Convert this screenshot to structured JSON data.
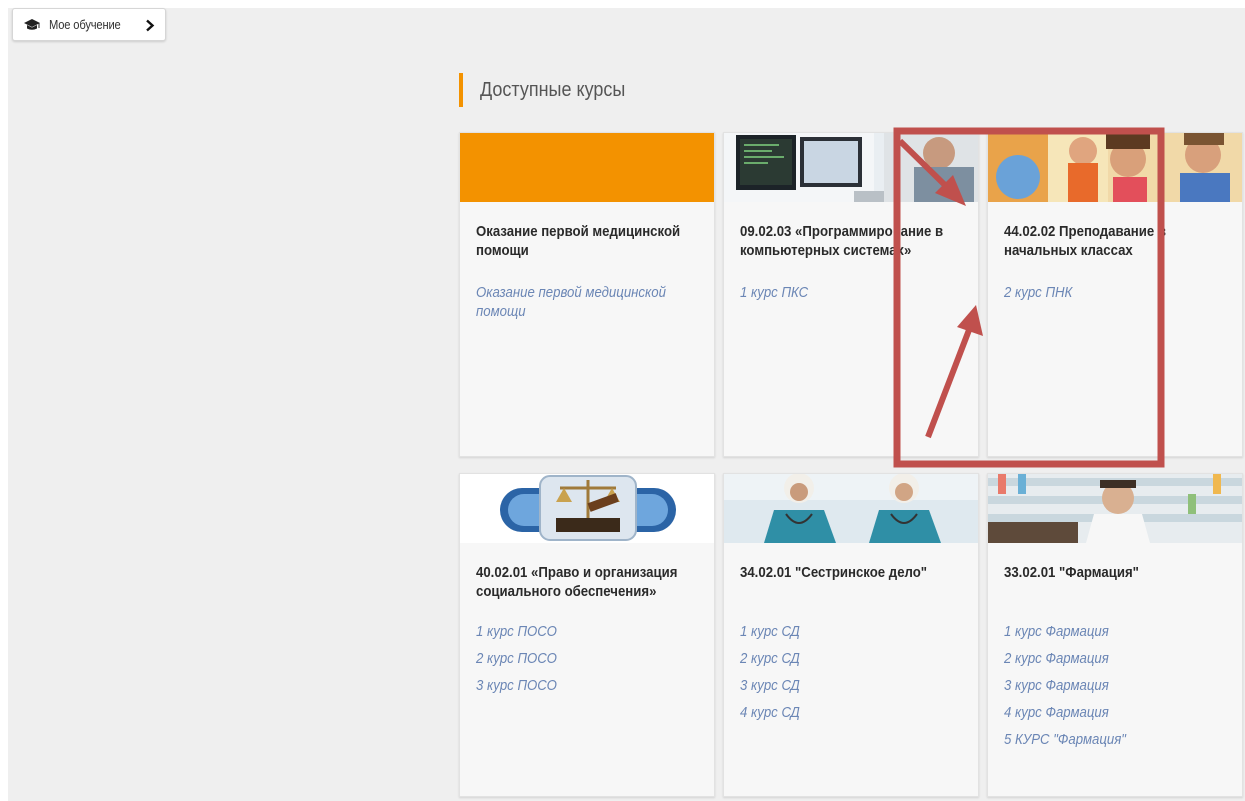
{
  "breadcrumb": {
    "label": "Мое обучение",
    "icon": "graduation-cap-icon",
    "chevron": "chevron-right-icon"
  },
  "section": {
    "title": "Доступные курсы",
    "accent": "#f39200"
  },
  "courses": [
    {
      "title": "Оказание первой медицинской помощи",
      "links": [
        "Оказание первой медицинской помощи"
      ]
    },
    {
      "title": "09.02.03 «Программирование в компьютерных системах»",
      "links": [
        "1 курс ПКС"
      ]
    },
    {
      "title": "44.02.02 Преподавание в начальных классах",
      "links": [
        "2 курс ПНК"
      ]
    },
    {
      "title": "40.02.01 «Право и организация социального обеспечения»",
      "links": [
        "1 курс ПОСО",
        "2 курс ПОСО",
        "3 курс ПОСО"
      ]
    },
    {
      "title": "34.02.01 \"Сестринское дело\"",
      "links": [
        "1 курс СД",
        "2 курс СД",
        "3 курс СД",
        "4 курс СД"
      ]
    },
    {
      "title": "33.02.01 \"Фармация\"",
      "links": [
        "1 курс Фармация",
        "2 курс Фармация",
        "3 курс Фармация",
        "4 курс Фармация",
        "5 КУРС \"Фармация\""
      ]
    }
  ],
  "colors": {
    "link": "#6b86b5",
    "annotation": "#c0504d",
    "orange_banner": "#f39200"
  }
}
